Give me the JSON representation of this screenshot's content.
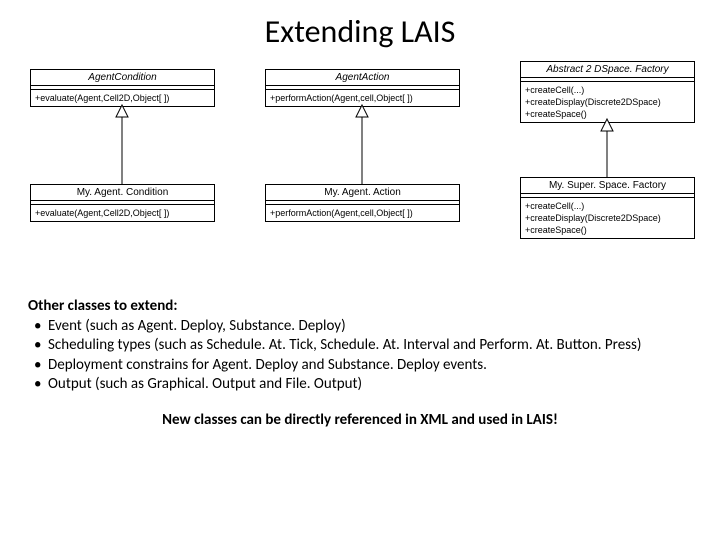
{
  "title": "Extending LAIS",
  "uml": {
    "agentCondition": {
      "name": "AgentCondition",
      "methods": [
        "+evaluate(Agent,Cell2D,Object[ ])"
      ]
    },
    "agentAction": {
      "name": "AgentAction",
      "methods": [
        "+performAction(Agent,cell,Object[ ])"
      ]
    },
    "abstractFactory": {
      "name": "Abstract 2 DSpace. Factory",
      "methods": [
        "+createCell(...)",
        "+createDisplay(Discrete2DSpace)",
        "+createSpace()"
      ]
    },
    "myAgentCondition": {
      "name": "My. Agent. Condition",
      "methods": [
        "+evaluate(Agent,Cell2D,Object[ ])"
      ]
    },
    "myAgentAction": {
      "name": "My. Agent. Action",
      "methods": [
        "+performAction(Agent,cell,Object[ ])"
      ]
    },
    "mySpaceFactory": {
      "name": "My. Super. Space. Factory",
      "methods": [
        "+createCell(...)",
        "+createDisplay(Discrete2DSpace)",
        "+createSpace()"
      ]
    }
  },
  "section_heading": "Other classes to extend:",
  "bullets": [
    "Event (such as Agent. Deploy, Substance. Deploy)",
    "Scheduling types (such as Schedule. At. Tick, Schedule. At. Interval and Perform. At. Button. Press)",
    "Deployment constrains for Agent. Deploy and Substance. Deploy events.",
    "Output (such as Graphical. Output and File. Output)"
  ],
  "footer": "New classes can be directly referenced in XML and used in LAIS!"
}
